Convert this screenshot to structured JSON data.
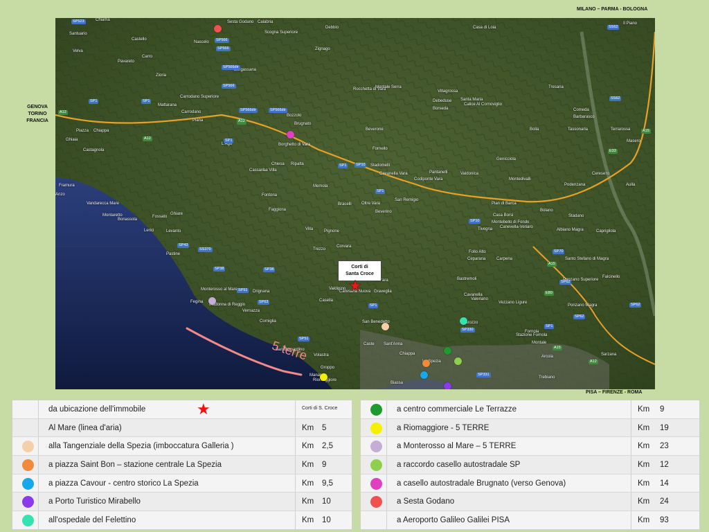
{
  "corner_labels": {
    "north_east": "MILANO – PARMA - BOLOGNA",
    "south_east": "PISA – FIRENZE - ROMA",
    "west": [
      "GENOVA",
      "TORINO",
      "FRANCIA"
    ]
  },
  "map": {
    "callout": [
      "Corti di",
      "Santa Croce"
    ],
    "sea_label": "5 terre",
    "places": [
      "Sesta Godano",
      "Calabria",
      "Scogna Superiore",
      "Debbio",
      "Casa di Loia",
      "Il Piano",
      "Chiama",
      "Santuario",
      "Velva",
      "Castello",
      "Nascelo",
      "Zignago",
      "Carro",
      "Pavareto",
      "Zioria",
      "Mattarana",
      "Carrodano Superiore",
      "Carrodano",
      "Bergassana",
      "Bozzolo",
      "Brugnato",
      "Rocchetta di Vara",
      "Montale Serra",
      "Villagrossa",
      "Santa Maria",
      "Debeduse",
      "Borseda",
      "Calice Al Cornoviglio",
      "Tresana",
      "Comeda",
      "Barbarasco",
      "Bolla",
      "Tassonarla",
      "Terrarossa",
      "Masero",
      "Piana",
      "Chiappa",
      "Ghiaia",
      "Piazza",
      "Castagnola",
      "L'Ago",
      "Borghetto di Vara",
      "Beverone",
      "Fornello",
      "Stadomelli",
      "Cavanella Vara",
      "Genicciola",
      "Montedivalli",
      "Ceresето",
      "Podenzana",
      "Aulla",
      "Chiesa",
      "Ripalta",
      "Cassana",
      "La Villa",
      "Memola",
      "Pantanelli",
      "Valdonica",
      "Codiponte Vara",
      "San Remigio",
      "Bracelli",
      "Beverino",
      "Oltre Vara",
      "Framura",
      "Anzo",
      "Vandarecca Mare",
      "Montaretto",
      "Bonassola",
      "Fossato",
      "Ghiare",
      "Lerici",
      "Levanto",
      "Pastine",
      "Fontona",
      "Faggiona",
      "Villa",
      "Pignone",
      "Trezzo",
      "Corvara",
      "Pian di Barca",
      "Casa Borsi",
      "Montebello di Fondo",
      "Bolano",
      "Canevella-Veriaro",
      "Stadano",
      "Albiano Magra",
      "Caprigliola",
      "Tivegna",
      "Follo Alto",
      "Ceparana",
      "Carpena",
      "Santo Stefano di Magra",
      "Ponzano Superiore",
      "Falcinello",
      "Monterosso al Mare",
      "Fegina",
      "Madonna di Reggio",
      "Drignana",
      "Vernazza",
      "Casella",
      "Valdipino",
      "Caresana Nuova",
      "Polverara",
      "Gravegliа",
      "Bastremoli",
      "Cavanella",
      "Valeriano",
      "Vezzano Ligure",
      "Ponzano Magra",
      "Fornola",
      "Corniglia",
      "San Bernardino",
      "Volastra",
      "Groppo",
      "Manarola",
      "Riomaggiore",
      "San Benedetto",
      "Caste",
      "Sant'Anna",
      "Chiappa",
      "La Spezia",
      "Carozzo",
      "Stazione Fornola",
      "Montale",
      "Arcola",
      "Sarzana",
      "Trebiano",
      "Biassa"
    ],
    "roads": [
      "SP523",
      "SP566",
      "SP566",
      "SP566dir",
      "SP566",
      "SP1",
      "SP1",
      "A12",
      "A12",
      "SP566dir",
      "SP566dir",
      "A12",
      "SP1",
      "A12",
      "SP1",
      "SP10",
      "SP1",
      "SP10",
      "SP43",
      "SS370",
      "SP38",
      "SP38",
      "SP51",
      "SP63",
      "SP1",
      "SP51",
      "SP330",
      "SP331",
      "SP70",
      "A15",
      "SP62",
      "SP62",
      "SS62",
      "SS62",
      "A15",
      "E33",
      "SP1",
      "A12",
      "SP62",
      "A15",
      "E80"
    ],
    "markers": [
      {
        "name": "Sesta Godano",
        "color": "#f05050"
      },
      {
        "name": "casello Brugnato",
        "color": "#e040c0"
      },
      {
        "name": "Monterosso",
        "color": "#c5aed6"
      },
      {
        "name": "Tangenziale",
        "color": "#f5cfa8"
      },
      {
        "name": "Ospedale",
        "color": "#35e2b0"
      },
      {
        "name": "Le Terrazze",
        "color": "#1e9a2e"
      },
      {
        "name": "raccordo SP",
        "color": "#8ed04e"
      },
      {
        "name": "Saint Bon",
        "color": "#f08a3c"
      },
      {
        "name": "Cavour",
        "color": "#17a8e8"
      },
      {
        "name": "Mirabello",
        "color": "#8a3ae8"
      },
      {
        "name": "Riomaggiore",
        "color": "#f4f000"
      }
    ]
  },
  "legend_left": [
    {
      "icon": "star",
      "label": "da ubicazione dell'immobile",
      "unit": "",
      "value": "",
      "note": "Corti di S. Croce"
    },
    {
      "icon": "none",
      "label": "Al Mare (linea d'aria)",
      "unit": "Km",
      "value": "5"
    },
    {
      "icon": "dot",
      "color": "#f5cfa8",
      "label": "alla Tangenziale della Spezia (imboccatura Galleria )",
      "unit": "Km",
      "value": "2,5"
    },
    {
      "icon": "dot",
      "color": "#f08a3c",
      "label": "a piazza Saint Bon – stazione centrale La Spezia",
      "unit": "Km",
      "value": "9"
    },
    {
      "icon": "dot",
      "color": "#17a8e8",
      "label": "a piazza Cavour  - centro storico  La Spezia",
      "unit": "Km",
      "value": "9,5"
    },
    {
      "icon": "dot",
      "color": "#8a3ae8",
      "label": "a Porto Turistico Mirabello",
      "unit": "Km",
      "value": "10"
    },
    {
      "icon": "dot",
      "color": "#35e2b0",
      "label": "all'ospedale del Felettino",
      "unit": "Km",
      "value": "10"
    }
  ],
  "legend_right": [
    {
      "icon": "dot",
      "color": "#1e9a2e",
      "label": "a centro commerciale Le Terrazze",
      "unit": "Km",
      "value": "9"
    },
    {
      "icon": "dot",
      "color": "#f4f000",
      "label": "a Riomaggiore - 5 TERRE",
      "unit": "Km",
      "value": "19"
    },
    {
      "icon": "dot",
      "color": "#c5aed6",
      "label": "a Monterosso al Mare – 5 TERRE",
      "unit": "Km",
      "value": "23"
    },
    {
      "icon": "dot",
      "color": "#8ed04e",
      "label": "a raccordo casello autostradale SP",
      "unit": "Km",
      "value": "12"
    },
    {
      "icon": "dot",
      "color": "#e040c0",
      "label": "a casello autostradale Brugnato (verso Genova)",
      "unit": "Km",
      "value": "14"
    },
    {
      "icon": "dot",
      "color": "#f05050",
      "label": "a Sesta Godano",
      "unit": "Km",
      "value": "24"
    },
    {
      "icon": "none",
      "label": "a Aeroporto Galileo Galilei PISA",
      "unit": "Km",
      "value": "93"
    }
  ]
}
